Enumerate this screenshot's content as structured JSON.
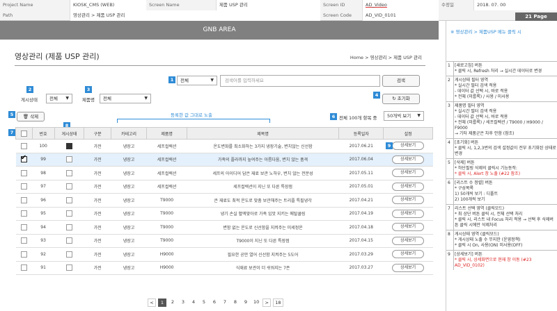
{
  "meta": {
    "project_name_label": "Project Name",
    "project_name": "KIOSK_CMS (WEB)",
    "screen_name_label": "Screen Name",
    "screen_name": "제품 USP 관리",
    "screen_id_label": "Screen ID",
    "screen_id": "AD_Video",
    "date_label": "수정일",
    "date": "2018. 07. 00",
    "path_label": "Path",
    "path": "영상관리 > 제품 USP 관리",
    "screen_code_label": "Screen Code",
    "screen_code": "AD_VID_0101",
    "page": "21 Page"
  },
  "gnb": "GNB AREA",
  "page_title": "영상관리 (제품 USP 관리)",
  "breadcrumb": "Home > 영상관리 > 제품 USP 관리",
  "search": {
    "badge": "1",
    "scope": "전체",
    "placeholder": "검색어를 입력하세요",
    "button": "검색"
  },
  "filters": {
    "status_badge": "2",
    "status_label": "게시상태",
    "status_value": "전체",
    "product_badge": "3",
    "product_label": "제품명",
    "product_value": "전체",
    "reset_badge": "4",
    "reset_button": "초기화"
  },
  "toolbar": {
    "delete_badge": "5",
    "delete_button": "삭제",
    "note": "등록한 값 그대로 노출",
    "count_badge": "6",
    "count_text": "전체 100개 항목 중",
    "pagesize": "50개씩 보기"
  },
  "table": {
    "check_badge": "7",
    "status_badge": "8",
    "detail_badge": "9",
    "headers": [
      "",
      "번호",
      "게시상태",
      "구분",
      "카테고리",
      "제품명",
      "제목명",
      "등록일자",
      "설정"
    ],
    "detail_label": "상세보기",
    "rows": [
      {
        "no": "100",
        "type": "가전",
        "cat": "냉장고",
        "product": "세프컬렉션",
        "title": "온도변화를 최소화하는 3가지 냉장기술, 변치않는 신선함",
        "date": "2017.06.21"
      },
      {
        "no": "99",
        "type": "가전",
        "cat": "냉장고",
        "product": "세프컬렉션",
        "title": "가족의 플라까지 높여주는 아름다움, 변치 않는 품격",
        "date": "2017.06.04"
      },
      {
        "no": "98",
        "type": "가전",
        "cat": "냉장고",
        "product": "세프컬렉션",
        "title": "세프의 아이디어 담은 재료 보관 노하우, 변치 않는 전문성",
        "date": "2017.05.11"
      },
      {
        "no": "97",
        "type": "가전",
        "cat": "냉장고",
        "product": "세프컬렉션",
        "title": "세프컬렉션이 지닌 또 다른 특장점",
        "date": "2017.05.01"
      },
      {
        "no": "96",
        "type": "가전",
        "cat": "냉장고",
        "product": "T9000",
        "title": "큰 재료도 최적 온도로 맞춤 보관해주는 트리플 특필냉각",
        "date": "2017.04.21"
      },
      {
        "no": "95",
        "type": "가전",
        "cat": "냉장고",
        "product": "T9000",
        "title": "냉기 손실 혈액맞아로 가족 입맛 지키는 메탈쿨링",
        "date": "2017.04.19"
      },
      {
        "no": "94",
        "type": "가전",
        "cat": "냉장고",
        "product": "T9000",
        "title": "변함 없는 온도로 신선함을 지켜주는 미세정온",
        "date": "2017.04.18"
      },
      {
        "no": "93",
        "type": "가전",
        "cat": "냉장고",
        "product": "T9000",
        "title": "T9000이 지닌 또 다른 특장점",
        "date": "2017.04.15"
      },
      {
        "no": "92",
        "type": "가전",
        "cat": "냉장고",
        "product": "H9000",
        "title": "필요한 공만 열어 신선함 지켜주는 5도어",
        "date": "2017.03.29"
      },
      {
        "no": "91",
        "type": "가전",
        "cat": "냉장고",
        "product": "H9000",
        "title": "식재료 보관이 더 쉬워지는 7존",
        "date": "2017.03.27"
      }
    ]
  },
  "pager": [
    "<",
    "1",
    "2",
    "3",
    "4",
    "5",
    "6",
    "7",
    "8",
    "9",
    "10",
    ">",
    "18"
  ],
  "side": {
    "heading": "※ 영상관리 > 제품USP 메뉴 클릭 시",
    "items": [
      {
        "num": "1",
        "lines": [
          "[새로고침] 버튼",
          "* 클릭 시, Refresh 처리 → 실시간 데이터로 변경"
        ]
      },
      {
        "num": "2",
        "lines": [
          "게시상태 필터 영역",
          "* 실시간 필터 검색 적용",
          "- 데이터 값 선택 시, 바로 적용",
          "* 전체 (미룹록) / 사용 / 미사용"
        ]
      },
      {
        "num": "3",
        "lines": [
          "제품명 필터 영역",
          "* 실시간 필터 검색 적용",
          "- 데이터 값 선택 시, 바로 적용",
          "* 전체 (미룹록) / 세프컬렉션 / T9000 / H9000 / F9000",
          "→ 기타 제품군은 차후 안함 (참조)"
        ]
      },
      {
        "num": "4",
        "lines": [
          "[초기화] 버튼",
          "* 클릭 시, 1,2,3번의 검색 설정값이 전부 초기화된 상태로 변경"
        ]
      },
      {
        "num": "5",
        "lines": [
          "[삭제] 버튼",
          "* 하단필링 삭제의 클릭시 기능동작:",
          "* 클릭 시, Alert 창 노출 (#22 참조)"
        ]
      },
      {
        "num": "6",
        "lines": [
          "[리스트 수 정렬] 버튼",
          "* 구성목록",
          "1) 50개씩 보기 : 디폴트",
          "2) 100개씩 보기"
        ]
      },
      {
        "num": "7",
        "lines": [
          "리스트 선택 영역 (클릭모드)",
          "* 최 상단 버튼 클릭 시, 전체 선택 처리",
          "* 클릭 시, 리스트 내 Focus 처리 적용 → 선택 후 삭제버튼 클릭 시에만 삭제처리"
        ]
      },
      {
        "num": "8",
        "lines": [
          "게시상태 영역 (클릭모드)",
          "* 게시상태 노출 수 무지한 (운영정책)",
          "* 클릭 시 On, 사용(ON) 미사용(OFF)"
        ]
      },
      {
        "num": "9",
        "lines": [
          "[상세보기] 버튼",
          "* 클릭 시, 상세화면으로 현재 창 이동 (#23 AD_VID_0102)"
        ]
      }
    ]
  }
}
